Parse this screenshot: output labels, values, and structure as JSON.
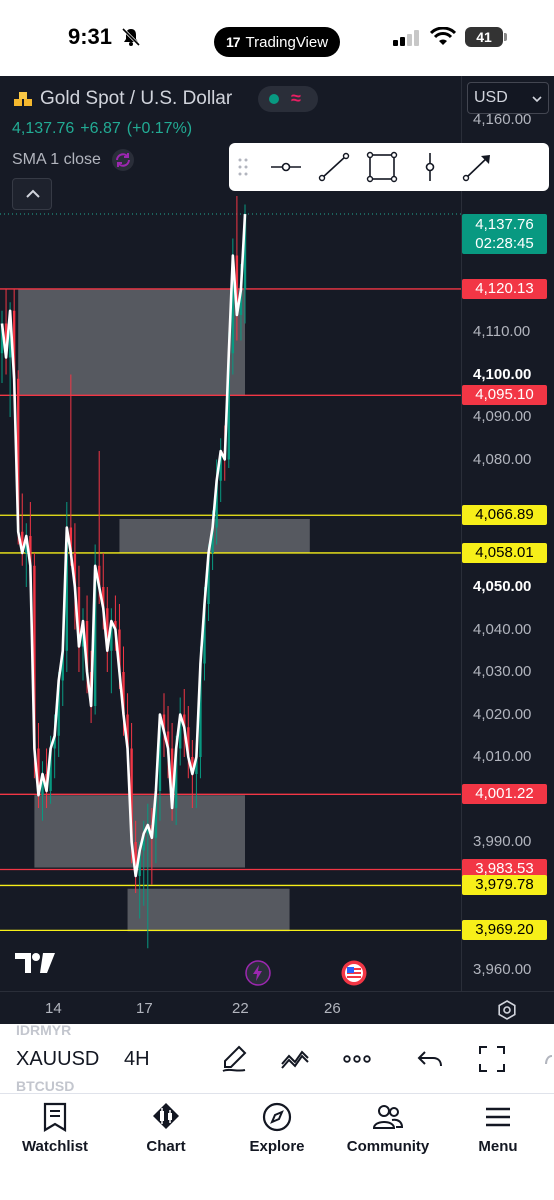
{
  "status_bar": {
    "time": "9:31",
    "app_pill": "TradingView",
    "battery": "41"
  },
  "header": {
    "title": "Gold Spot / U.S. Dollar",
    "price": "4,137.76",
    "change": "+6.87",
    "change_pct": "(+0.17%)",
    "indicator": "SMA 1 close",
    "currency": "USD"
  },
  "colors": {
    "background": "#161a25",
    "up": "#089981",
    "down": "#f23645",
    "level_red": "#f23645",
    "level_yellow": "#f7ef19",
    "line": "#ffffff"
  },
  "price_axis": {
    "ticks": [
      {
        "label": "4,160.00",
        "value": 4160,
        "bold": false
      },
      {
        "label": "4,110.00",
        "value": 4110,
        "bold": false
      },
      {
        "label": "4,100.00",
        "value": 4100,
        "bold": true
      },
      {
        "label": "4,090.00",
        "value": 4090,
        "bold": false
      },
      {
        "label": "4,080.00",
        "value": 4080,
        "bold": false
      },
      {
        "label": "4,050.00",
        "value": 4050,
        "bold": true
      },
      {
        "label": "4,040.00",
        "value": 4040,
        "bold": false
      },
      {
        "label": "4,030.00",
        "value": 4030,
        "bold": false
      },
      {
        "label": "4,020.00",
        "value": 4020,
        "bold": false
      },
      {
        "label": "4,010.00",
        "value": 4010,
        "bold": false
      },
      {
        "label": "3,990.00",
        "value": 3990,
        "bold": false
      },
      {
        "label": "3,960.00",
        "value": 3960,
        "bold": false
      }
    ],
    "current": {
      "price": "4,137.76",
      "countdown": "02:28:45"
    },
    "level_tags": [
      {
        "label": "4,120.13",
        "value": 4120.13,
        "color": "red"
      },
      {
        "label": "4,095.10",
        "value": 4095.1,
        "color": "red"
      },
      {
        "label": "4,066.89",
        "value": 4066.89,
        "color": "yellow"
      },
      {
        "label": "4,058.01",
        "value": 4058.01,
        "color": "yellow"
      },
      {
        "label": "4,001.22",
        "value": 4001.22,
        "color": "red"
      },
      {
        "label": "3,983.53",
        "value": 3983.53,
        "color": "red"
      },
      {
        "label": "3,979.78",
        "value": 3979.78,
        "color": "yellow"
      },
      {
        "label": "3,969.20",
        "value": 3969.2,
        "color": "yellow"
      }
    ]
  },
  "time_axis": {
    "labels": [
      "14",
      "17",
      "22",
      "26"
    ]
  },
  "drawing_tools": [
    "horizontal-line-icon",
    "trend-line-icon",
    "rectangle-icon",
    "vertical-line-icon",
    "arrow-icon"
  ],
  "chart_data": {
    "type": "candlestick",
    "symbol": "XAUUSD",
    "interval": "4H",
    "ylim": [
      3958,
      4165
    ],
    "levels": [
      4120.13,
      4095.1,
      4066.89,
      4058.01,
      4001.22,
      3983.53,
      3979.78,
      3969.2
    ],
    "zones": [
      {
        "from_bar": 4,
        "to_bar": 60,
        "low": 4095,
        "high": 4120
      },
      {
        "from_bar": 29,
        "to_bar": 76,
        "low": 4058,
        "high": 4066
      },
      {
        "from_bar": 8,
        "to_bar": 60,
        "low": 3984,
        "high": 4001
      },
      {
        "from_bar": 31,
        "to_bar": 71,
        "low": 3969,
        "high": 3979
      }
    ],
    "candles": [
      [
        4105,
        4115,
        4098,
        4112
      ],
      [
        4112,
        4120,
        4100,
        4104
      ],
      [
        4104,
        4117,
        4090,
        4115
      ],
      [
        4115,
        4120,
        4095,
        4099
      ],
      [
        4099,
        4101,
        4060,
        4063
      ],
      [
        4063,
        4072,
        4055,
        4058
      ],
      [
        4058,
        4065,
        4050,
        4062
      ],
      [
        4062,
        4070,
        4052,
        4055
      ],
      [
        4055,
        4058,
        4005,
        4012
      ],
      [
        4012,
        4018,
        3998,
        4001
      ],
      [
        4001,
        4009,
        3995,
        4006
      ],
      [
        4006,
        4012,
        3998,
        4002
      ],
      [
        4002,
        4015,
        3999,
        4012
      ],
      [
        4012,
        4020,
        4005,
        4015
      ],
      [
        4015,
        4030,
        4010,
        4028
      ],
      [
        4028,
        4040,
        4022,
        4035
      ],
      [
        4035,
        4070,
        4030,
        4064
      ],
      [
        4064,
        4100,
        4055,
        4058
      ],
      [
        4058,
        4065,
        4040,
        4050
      ],
      [
        4050,
        4055,
        4030,
        4036
      ],
      [
        4036,
        4045,
        4028,
        4042
      ],
      [
        4042,
        4048,
        4025,
        4030
      ],
      [
        4030,
        4035,
        4018,
        4022
      ],
      [
        4022,
        4060,
        4020,
        4055
      ],
      [
        4055,
        4082,
        4046,
        4050
      ],
      [
        4050,
        4058,
        4040,
        4045
      ],
      [
        4045,
        4050,
        4030,
        4035
      ],
      [
        4035,
        4045,
        4025,
        4042
      ],
      [
        4042,
        4048,
        4035,
        4040
      ],
      [
        4040,
        4046,
        4026,
        4030
      ],
      [
        4030,
        4036,
        4015,
        4020
      ],
      [
        4020,
        4025,
        4008,
        4012
      ],
      [
        4012,
        4018,
        3985,
        3990
      ],
      [
        3990,
        3995,
        3978,
        3982
      ],
      [
        3982,
        3990,
        3972,
        3988
      ],
      [
        3988,
        3995,
        3975,
        3992
      ],
      [
        3992,
        3999,
        3965,
        3994
      ],
      [
        3994,
        3998,
        3980,
        3991
      ],
      [
        3991,
        4005,
        3985,
        4002
      ],
      [
        4002,
        4015,
        3995,
        4020
      ],
      [
        4020,
        4025,
        4010,
        4016
      ],
      [
        4016,
        4022,
        4005,
        4012
      ],
      [
        4012,
        4018,
        3995,
        3998
      ],
      [
        3998,
        4015,
        3994,
        4012
      ],
      [
        4012,
        4024,
        4008,
        4020
      ],
      [
        4020,
        4026,
        4010,
        4017
      ],
      [
        4017,
        4022,
        4005,
        4010
      ],
      [
        4010,
        4014,
        3998,
        4006
      ],
      [
        4006,
        4012,
        3998,
        4010
      ],
      [
        4010,
        4036,
        4005,
        4032
      ],
      [
        4032,
        4050,
        4028,
        4046
      ],
      [
        4046,
        4060,
        4042,
        4058
      ],
      [
        4058,
        4068,
        4054,
        4064
      ],
      [
        4064,
        4080,
        4060,
        4075
      ],
      [
        4075,
        4085,
        4070,
        4082
      ],
      [
        4082,
        4088,
        4075,
        4080
      ],
      [
        4080,
        4110,
        4078,
        4105
      ],
      [
        4105,
        4132,
        4100,
        4128
      ],
      [
        4128,
        4142,
        4108,
        4114
      ],
      [
        4114,
        4126,
        4108,
        4120
      ],
      [
        4120,
        4140,
        4112,
        4137.76
      ]
    ]
  },
  "symbol_bar": {
    "ticker": "XAUUSD",
    "interval": "4H",
    "ghost_top": "IDRMYR",
    "ghost_bottom": "BTCUSD"
  },
  "bottom_nav": [
    "Watchlist",
    "Chart",
    "Explore",
    "Community",
    "Menu"
  ]
}
